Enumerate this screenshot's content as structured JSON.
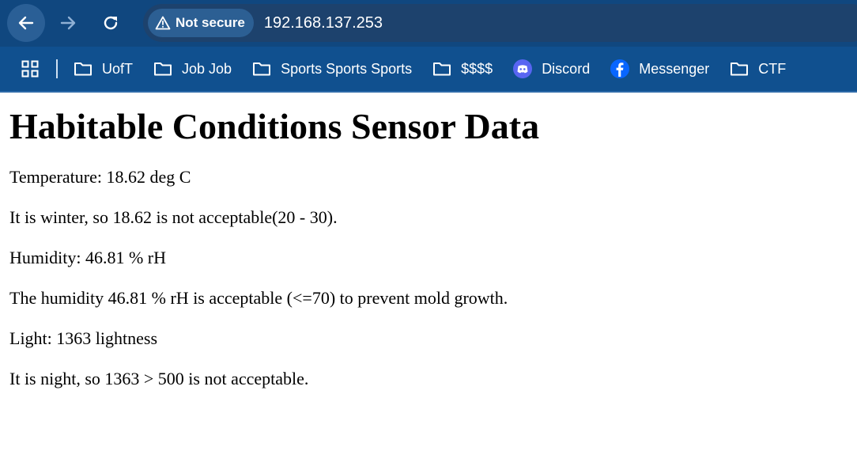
{
  "browser": {
    "security_label": "Not secure",
    "url": "192.168.137.253",
    "bookmarks": [
      {
        "label": "UofT",
        "icon": "folder-icon"
      },
      {
        "label": "Job Job",
        "icon": "folder-icon"
      },
      {
        "label": "Sports Sports Sports",
        "icon": "folder-icon"
      },
      {
        "label": "$$$$",
        "icon": "folder-icon"
      },
      {
        "label": "Discord",
        "icon": "discord-icon"
      },
      {
        "label": "Messenger",
        "icon": "messenger-icon"
      },
      {
        "label": "CTF",
        "icon": "folder-icon"
      }
    ],
    "colors": {
      "toolbar": "#10477f",
      "bookmarks_bar": "#10508f",
      "discord": "#5865f2",
      "messenger": "#0866ff"
    }
  },
  "page": {
    "title": "Habitable Conditions Sensor Data",
    "lines": [
      "Temperature: 18.62 deg C",
      "It is winter, so 18.62 is not acceptable(20 - 30).",
      "Humidity: 46.81 % rH",
      "The humidity 46.81 % rH is acceptable (<=70) to prevent mold growth.",
      "Light: 1363 lightness",
      "It is night, so 1363 > 500 is not acceptable."
    ]
  }
}
